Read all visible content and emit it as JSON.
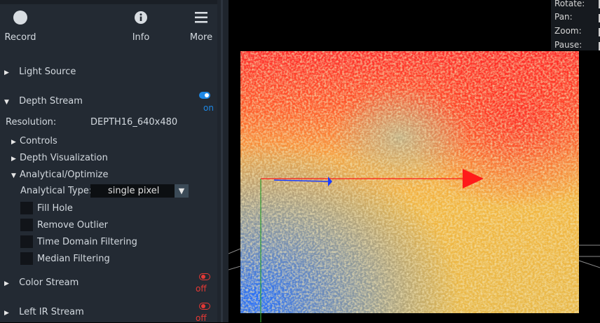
{
  "toolbar": {
    "record": {
      "label": "Record",
      "icon": "record-icon"
    },
    "info": {
      "label": "Info",
      "icon": "info-icon"
    },
    "more": {
      "label": "More",
      "icon": "hamburger-menu-icon"
    }
  },
  "sections": {
    "light_source": {
      "label": "Light Source",
      "expanded": false
    },
    "depth_stream": {
      "label": "Depth Stream",
      "expanded": true,
      "toggle": "on"
    },
    "color_stream": {
      "label": "Color Stream",
      "expanded": false,
      "toggle": "off"
    },
    "left_ir_stream": {
      "label": "Left IR Stream",
      "expanded": false,
      "toggle": "off"
    }
  },
  "depth": {
    "resolution_label": "Resolution:",
    "resolution_value": "DEPTH16_640x480",
    "controls_label": "Controls",
    "visualization_label": "Depth Visualization",
    "analytical_label": "Analytical/Optimize",
    "analytical_type_label": "Analytical Type:",
    "analytical_type_value": "single pixel",
    "checkboxes": [
      {
        "label": "Fill Hole",
        "checked": false
      },
      {
        "label": "Remove Outlier",
        "checked": false
      },
      {
        "label": "Time Domain Filtering",
        "checked": false
      },
      {
        "label": "Median Filtering",
        "checked": false
      }
    ]
  },
  "viewer": {
    "controls": [
      "Rotate:",
      "Pan:",
      "Zoom:",
      "Pause:"
    ]
  },
  "colors": {
    "sidebar_bg": "#232a33",
    "on_blue": "#1e88e5",
    "off_red": "#e53935",
    "axis_x": "#ff1a1a",
    "axis_y": "#1a3cff",
    "axis_z": "#2e9e2e"
  }
}
